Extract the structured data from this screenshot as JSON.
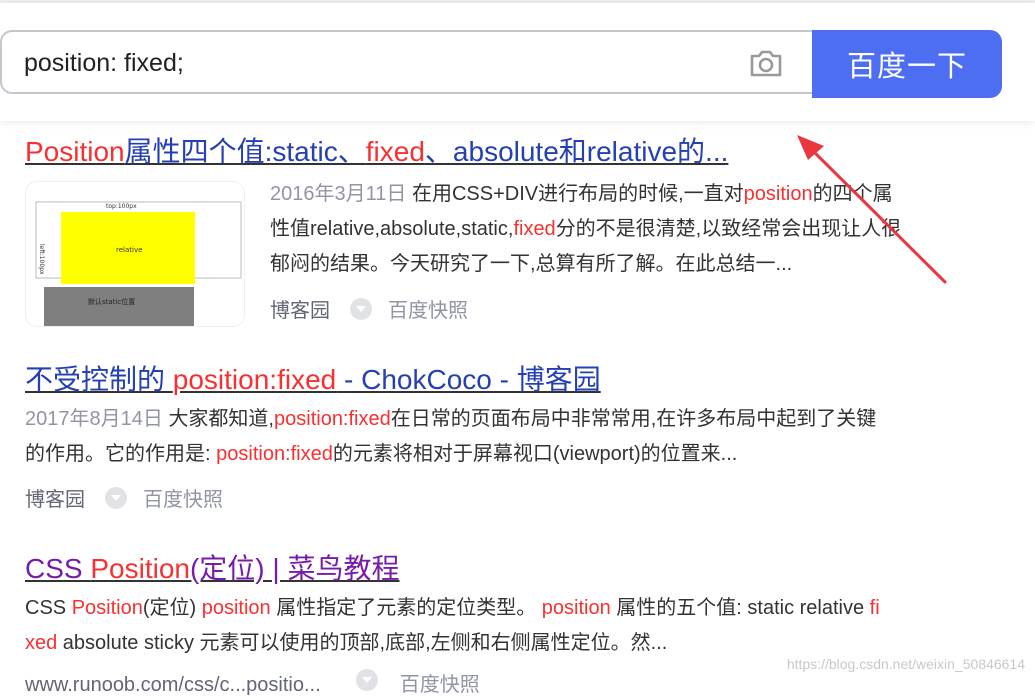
{
  "search": {
    "query": "position: fixed;",
    "button_label": "百度一下"
  },
  "results": [
    {
      "title_parts": [
        "Position",
        "属性四个值:static、",
        "fixed",
        "、absolute和relative的..."
      ],
      "date": "2016年3月11日",
      "snippet_line1_a": "在用CSS+DIV进行布局的时候,一直对",
      "snippet_line1_hl": "position",
      "snippet_line1_b": "的四个属",
      "snippet_line2_a": "性值relative,absolute,static,",
      "snippet_line2_hl": "fixed",
      "snippet_line2_b": "分的不是很清楚,以致经常会出现让人很",
      "snippet_line3": "郁闷的结果。今天研究了一下,总算有所了解。在此总结一...",
      "source": "博客园",
      "snapshot": "百度快照",
      "thumbnail": {
        "top_label": "top:100px",
        "left_label": "left:100px",
        "box_label": "relative",
        "bottom_label": "默认static位置"
      }
    },
    {
      "title_parts": [
        "不受控制的 ",
        "position:fixed",
        " - ChokCoco - 博客园"
      ],
      "date": "2017年8月14日",
      "snippet_line1_a": "大家都知道,",
      "snippet_line1_hl": "position:fixed",
      "snippet_line1_b": "在日常的页面布局中非常常用,在许多布局中起到了关键",
      "snippet_line2_a": "的作用。它的作用是: ",
      "snippet_line2_hl": "position:fixed",
      "snippet_line2_b": "的元素将相对于屏幕视口(viewport)的位置来...",
      "source": "博客园",
      "snapshot": "百度快照"
    },
    {
      "title_parts": [
        "CSS ",
        "Position",
        "(定位) | 菜鸟教程"
      ],
      "snippet_line1_a": "CSS ",
      "snippet_line1_hl": "Position",
      "snippet_line1_b": "(定位) ",
      "snippet_line1_hl2": "position",
      "snippet_line1_c": " 属性指定了元素的定位类型。 ",
      "snippet_line1_hl3": "position",
      "snippet_line1_d": " 属性的五个值: static relative ",
      "snippet_line1_hl4": "fi",
      "snippet_line2_hl": "xed",
      "snippet_line2_b": " absolute sticky 元素可以使用的顶部,底部,左侧和右侧属性定位。然...",
      "source_partial": "www.runoob.com/css/c...positio...",
      "snapshot": "百度快照"
    }
  ],
  "watermark": "https://blog.csdn.net/weixin_50846614",
  "colors": {
    "accent": "#4e6ef2",
    "link": "#2440b3",
    "visited": "#771caa",
    "highlight": "#f73131",
    "arrow": "#e8383d"
  },
  "icons": {
    "camera": "camera-icon",
    "dropdown": "chevron-down-icon"
  }
}
